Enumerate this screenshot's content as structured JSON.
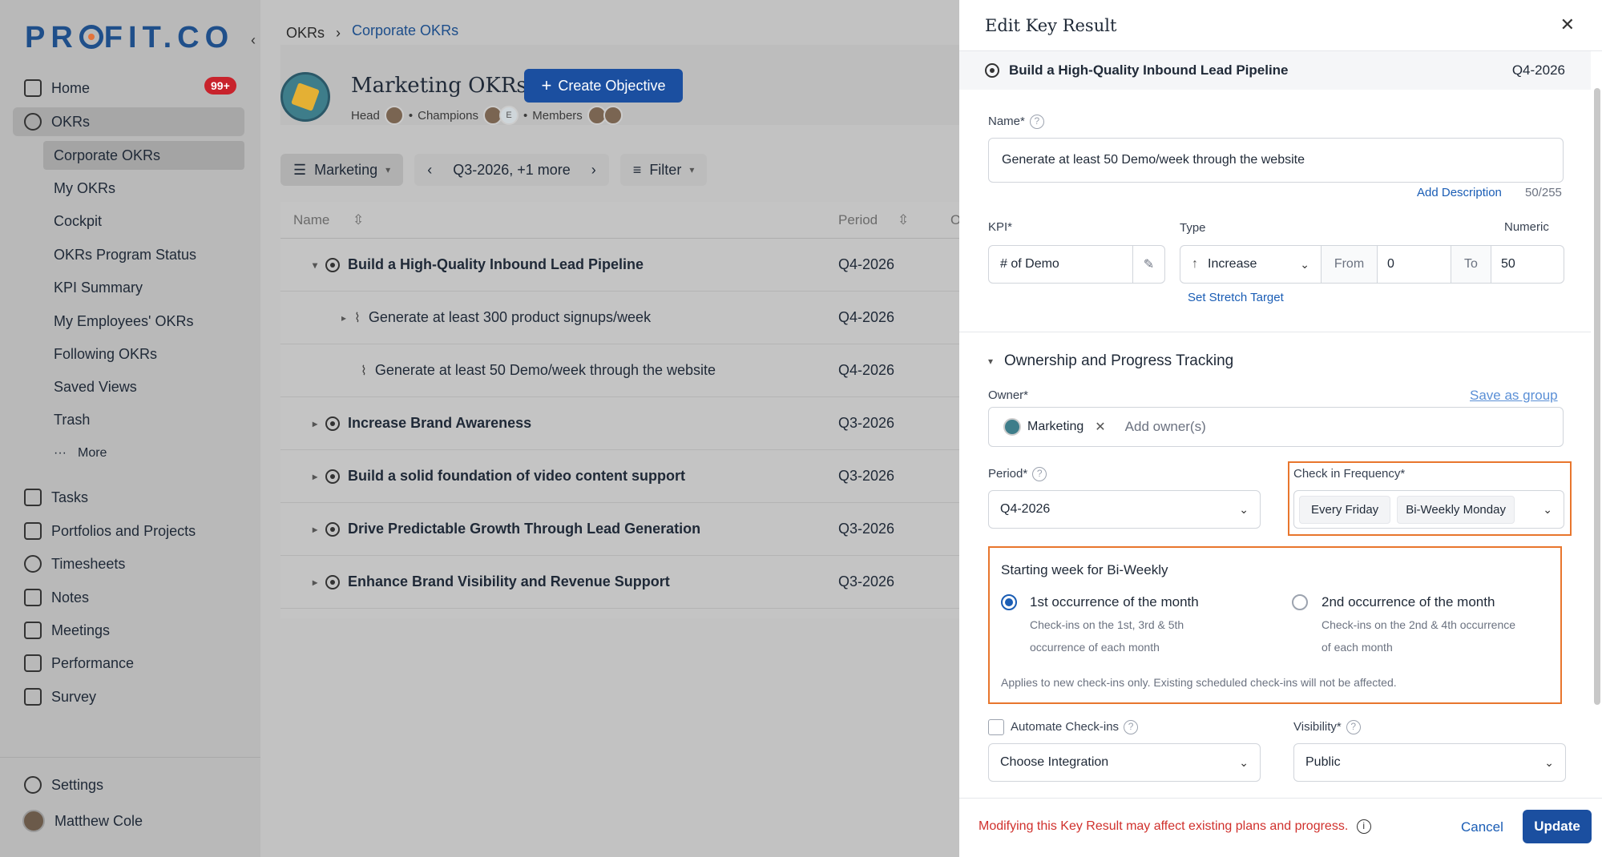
{
  "sidebar": {
    "logo": "PROFIT.CO",
    "home": "Home",
    "home_badge": "99+",
    "okrs": "OKRs",
    "sub_items": [
      "Corporate OKRs",
      "My OKRs",
      "Cockpit",
      "OKRs Program Status",
      "KPI Summary",
      "My Employees' OKRs",
      "Following OKRs",
      "Saved Views",
      "Trash"
    ],
    "more": "More",
    "items": [
      "Tasks",
      "Portfolios and Projects",
      "Timesheets",
      "Notes",
      "Meetings",
      "Performance",
      "Survey"
    ],
    "settings": "Settings",
    "user": "Matthew Cole"
  },
  "main": {
    "breadcrumb_root": "OKRs",
    "breadcrumb_current": "Corporate OKRs",
    "team_title": "Marketing OKRs",
    "create_objective": "Create Objective",
    "head_label": "Head",
    "champions_label": "Champions",
    "members_label": "Members",
    "champion_initial": "E",
    "filter_team": "Marketing",
    "filter_period": "Q3-2026, +1 more",
    "filter_label": "Filter",
    "col_name": "Name",
    "col_period": "Period",
    "col_next": "O",
    "rows": [
      {
        "name": "Build a High-Quality Inbound Lead Pipeline",
        "period": "Q4-2026"
      },
      {
        "name": "Generate at least 300 product signups/week",
        "period": "Q4-2026"
      },
      {
        "name": "Generate at least 50 Demo/week through the website",
        "period": "Q4-2026"
      },
      {
        "name": "Increase Brand Awareness",
        "period": "Q3-2026"
      },
      {
        "name": "Build a solid foundation of video content support",
        "period": "Q3-2026"
      },
      {
        "name": "Drive Predictable Growth Through Lead Generation",
        "period": "Q3-2026"
      },
      {
        "name": "Enhance Brand Visibility and Revenue Support",
        "period": "Q3-2026"
      }
    ]
  },
  "drawer": {
    "title": "Edit Key Result",
    "objective": "Build a High-Quality Inbound Lead Pipeline",
    "objective_period": "Q4-2026",
    "name_label": "Name*",
    "name_value": "Generate at least 50 Demo/week through the website",
    "add_description": "Add Description",
    "char_count": "50/255",
    "kpi_label": "KPI*",
    "kpi_value": "# of Demo",
    "type_label": "Type",
    "type_kind": "Numeric",
    "type_value": "Increase",
    "from_label": "From",
    "from_value": "0",
    "to_label": "To",
    "to_value": "50",
    "stretch": "Set Stretch Target",
    "section_title": "Ownership and Progress Tracking",
    "owner_label": "Owner*",
    "save_group": "Save as group",
    "owner_chip": "Marketing",
    "owner_placeholder": "Add owner(s)",
    "period_label": "Period*",
    "period_value": "Q4-2026",
    "freq_label": "Check in Frequency*",
    "freq_option1": "Every Friday",
    "freq_option2": "Bi-Weekly Monday",
    "start_title": "Starting week for Bi-Weekly",
    "opt1_title": "1st occurrence of the month",
    "opt1_desc1": "Check-ins on the 1st, 3rd & 5th",
    "opt1_desc2": "occurrence of each month",
    "opt2_title": "2nd occurrence of the month",
    "opt2_desc1": "Check-ins on the 2nd & 4th occurrence",
    "opt2_desc2": "of each month",
    "applies_note": "Applies to new check-ins only. Existing scheduled check-ins will not be affected.",
    "automate_label": "Automate Check-ins",
    "visibility_label": "Visibility*",
    "integration_value": "Choose Integration",
    "visibility_value": "Public",
    "warning": "Modifying this Key Result may affect existing plans and progress.",
    "cancel": "Cancel",
    "update": "Update"
  },
  "colors": {
    "brand": "#1b4fa0",
    "link": "#1a5db5",
    "highlight": "#e8762d",
    "warning": "#d0312d",
    "badge": "#c8232c"
  }
}
